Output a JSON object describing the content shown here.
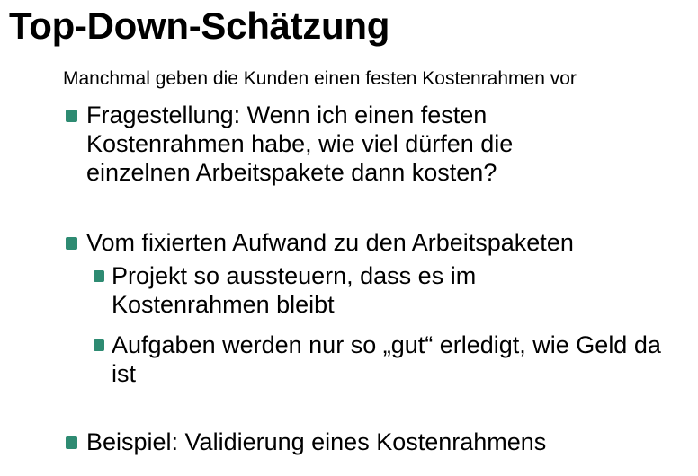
{
  "slide": {
    "title": "Top-Down-Schätzung",
    "subtitle": "Manchmal geben die Kunden einen festen Kostenrahmen vor",
    "bullets": [
      {
        "text": "Fragestellung: Wenn ich einen festen Kostenrahmen habe, wie viel dürfen die einzelnen Arbeitspakete dann kosten?"
      },
      {
        "text": "Vom fixierten Aufwand zu den Arbeitspaketen"
      },
      {
        "text": "Projekt so aussteuern, dass es im Kostenrahmen bleibt"
      },
      {
        "text": "Aufgaben werden nur so „gut“ erledigt, wie Geld da ist"
      },
      {
        "text": "Beispiel: Validierung eines Kostenrahmens"
      }
    ]
  },
  "colors": {
    "bullet_marker": "#2e8b72",
    "text": "#000000",
    "background": "#ffffff"
  }
}
